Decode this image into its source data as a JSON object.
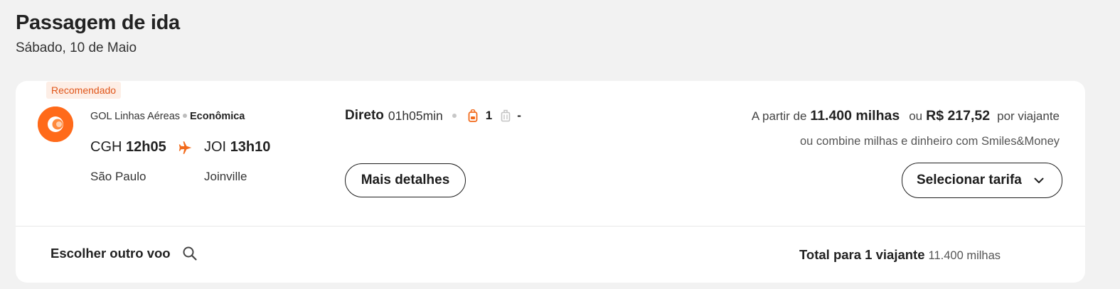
{
  "header": {
    "title": "Passagem de ida",
    "date": "Sábado, 10 de Maio"
  },
  "flight": {
    "badge": "Recomendado",
    "airline": "GOL Linhas Aéreas",
    "cabin": "Econômica",
    "origin": {
      "code": "CGH",
      "time": "12h05",
      "city": "São Paulo"
    },
    "destination": {
      "code": "JOI",
      "time": "13h10",
      "city": "Joinville"
    },
    "stops": "Direto",
    "duration": "01h05min",
    "carry_on_count": "1",
    "checked_bag_count": "-",
    "details_button": "Mais detalhes",
    "price": {
      "prefix": "A partir de",
      "miles": "11.400 milhas",
      "or": "ou",
      "money": "R$ 217,52",
      "suffix": "por viajante",
      "combine": "ou combine milhas e dinheiro com Smiles&Money"
    },
    "select_button": "Selecionar tarifa"
  },
  "footer": {
    "other_flight": "Escolher outro voo",
    "total_label": "Total para 1 viajante",
    "total_value": "11.400 milhas"
  },
  "colors": {
    "accent": "#ff6a1a",
    "badge_text": "#e0561a",
    "badge_bg": "#fdeee6"
  },
  "icons": {
    "plane": "plane-icon",
    "carry_on": "backpack-icon",
    "checked_bag": "luggage-icon",
    "search": "search-icon",
    "chevron": "chevron-down-icon",
    "logo": "gol-logo"
  }
}
